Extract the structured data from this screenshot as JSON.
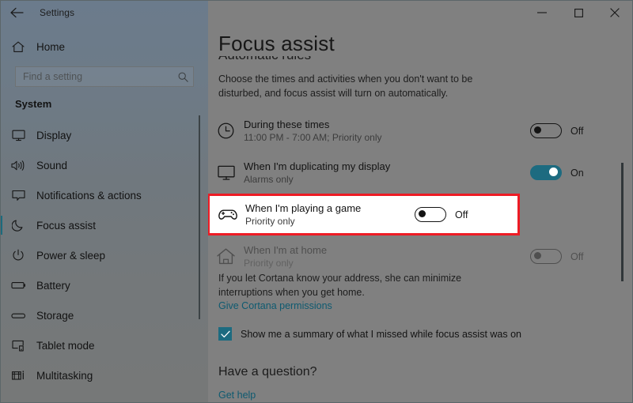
{
  "window": {
    "app_title": "Settings",
    "back_icon": "back-arrow-icon",
    "minimize_label": "‒",
    "maximize_label": "□",
    "close_label": "✕"
  },
  "sidebar": {
    "home_label": "Home",
    "home_icon": "home-icon",
    "search": {
      "placeholder": "Find a setting",
      "value": "",
      "icon": "search-icon"
    },
    "group_title": "System",
    "items": [
      {
        "label": "Display",
        "icon": "monitor-icon",
        "selected": false
      },
      {
        "label": "Sound",
        "icon": "speaker-icon",
        "selected": false
      },
      {
        "label": "Notifications & actions",
        "icon": "notification-icon",
        "selected": false
      },
      {
        "label": "Focus assist",
        "icon": "moon-icon",
        "selected": true
      },
      {
        "label": "Power & sleep",
        "icon": "power-icon",
        "selected": false
      },
      {
        "label": "Battery",
        "icon": "battery-icon",
        "selected": false
      },
      {
        "label": "Storage",
        "icon": "storage-icon",
        "selected": false
      },
      {
        "label": "Tablet mode",
        "icon": "tablet-icon",
        "selected": false
      },
      {
        "label": "Multitasking",
        "icon": "multitasking-icon",
        "selected": false
      }
    ]
  },
  "main": {
    "page_title": "Focus assist",
    "section_title": "Automatic rules",
    "section_description": "Choose the times and activities when you don't want to be disturbed, and focus assist will turn on automatically.",
    "rules": [
      {
        "title": "During these times",
        "subtitle": "11:00 PM - 7:00 AM; Priority only",
        "icon": "clock-icon",
        "state_label": "Off",
        "state_on": false,
        "highlighted": false,
        "disabled": false
      },
      {
        "title": "When I'm duplicating my display",
        "subtitle": "Alarms only",
        "icon": "monitor-icon",
        "state_label": "On",
        "state_on": true,
        "highlighted": false,
        "disabled": false
      },
      {
        "title": "When I'm playing a game",
        "subtitle": "Priority only",
        "icon": "gamepad-icon",
        "state_label": "Off",
        "state_on": false,
        "highlighted": true,
        "disabled": false
      },
      {
        "title": "When I'm at home",
        "subtitle": "Priority only",
        "icon": "house-icon",
        "state_label": "Off",
        "state_on": false,
        "highlighted": false,
        "disabled": true
      }
    ],
    "cortana_note": "If you let Cortana know your address, she can minimize interruptions when you get home.",
    "cortana_link": "Give Cortana permissions",
    "summary_checkbox_label": "Show me a summary of what I missed while focus assist was on",
    "summary_checked": true,
    "question_heading": "Have a question?",
    "get_help_link": "Get help"
  },
  "colors": {
    "accent": "#1d6b80",
    "highlight_border": "#ee1b24",
    "link": "#0e5a70",
    "content_bg": "#808080"
  }
}
